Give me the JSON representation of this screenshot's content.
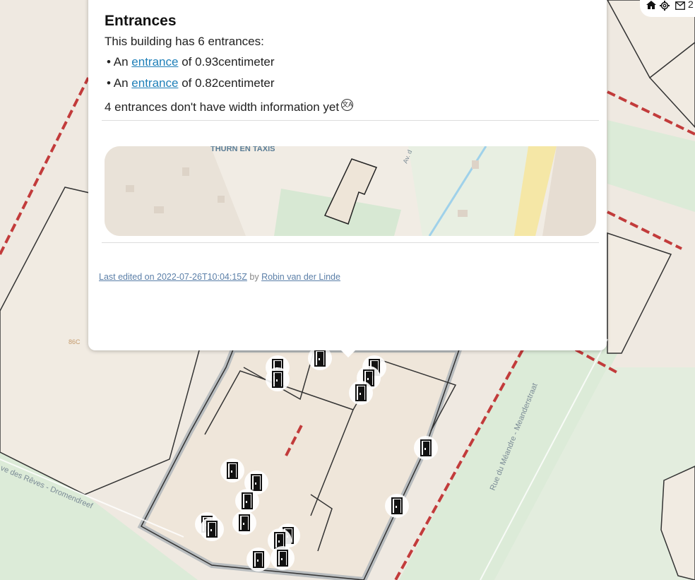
{
  "popup": {
    "title": "Entrances",
    "summary": "This building has 6 entrances:",
    "entrances": [
      {
        "bullet": "•",
        "prefix": "An",
        "link": "entrance",
        "suffix": "of 0.93centimeter"
      },
      {
        "bullet": "•",
        "prefix": "An",
        "link": "entrance",
        "suffix": "of 0.82centimeter"
      }
    ],
    "no_width_text": "4 entrances don't have width information yet",
    "minimap_label": "THURN EN TAXIS",
    "minimap_street": "Av. d",
    "edited_prefix": "Last edited on 2022-07-26T10:04:15Z",
    "edited_by": "by",
    "editor": "Robin van der Linde"
  },
  "map_labels": {
    "house_number": "86C",
    "street_left": "ve des Rêves - Dromendreef",
    "street_right": "Rue du Méandre - Meanderstraat"
  },
  "topbar": {
    "home_icon": "home-icon",
    "settings_icon": "gear-icon",
    "mail_icon": "mail-icon",
    "message_count": "2"
  },
  "colors": {
    "background": "#efe9e1",
    "building_fill": "#f1ebe2",
    "park_green": "#d9ebd9",
    "boundary_red": "#c23b3b",
    "link_blue": "#1e7fb8"
  }
}
